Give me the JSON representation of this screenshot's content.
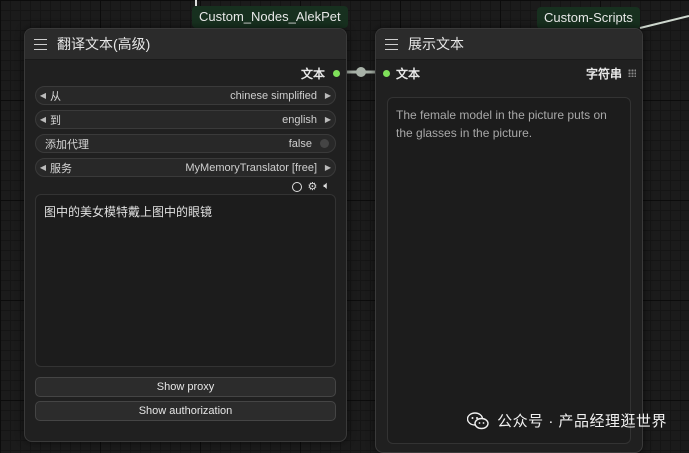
{
  "badges": {
    "left": "Custom_Nodes_AlekPet",
    "right": "Custom-Scripts"
  },
  "translate_node": {
    "title": "翻译文本(高级)",
    "output_label": "文本",
    "widgets": {
      "from": {
        "label": "从",
        "value": "chinese simplified"
      },
      "to": {
        "label": "到",
        "value": "english"
      },
      "proxy": {
        "label": "添加代理",
        "value": "false"
      },
      "service": {
        "label": "服务",
        "value": "MyMemoryTranslator [free]"
      }
    },
    "text": "图中的美女模特戴上图中的眼镜",
    "buttons": {
      "show_proxy": "Show proxy",
      "show_authorization": "Show authorization"
    }
  },
  "show_node": {
    "title": "展示文本",
    "input_label": "文本",
    "output_label": "字符串",
    "text": "The female model in the picture puts on the glasses in the picture."
  },
  "watermark": "公众号 · 产品经理逛世界",
  "colors": {
    "slot_dot": "#7fe05a",
    "badge_bg": "#17301f"
  }
}
